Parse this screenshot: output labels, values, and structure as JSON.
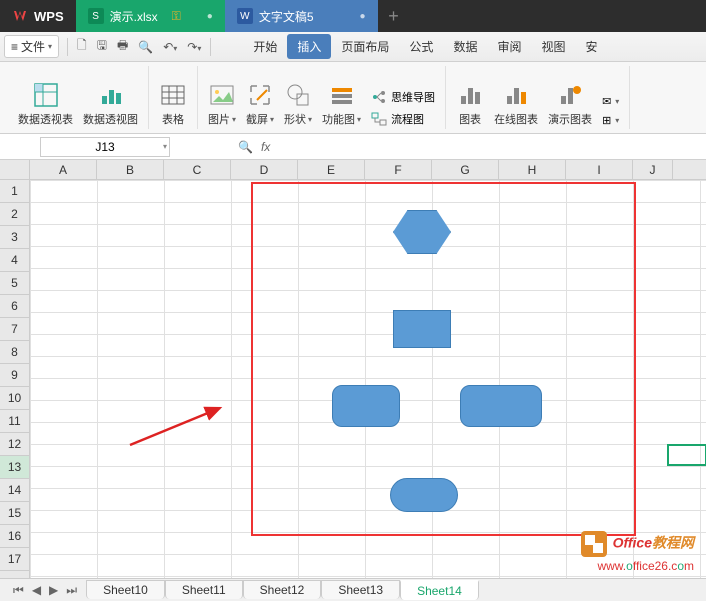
{
  "titlebar": {
    "app": "WPS",
    "tabs": [
      {
        "icon": "S",
        "label": "演示.xlsx",
        "type": "green"
      },
      {
        "icon": "W",
        "label": "文字文稿5",
        "type": "blue"
      }
    ]
  },
  "menubar": {
    "file": "文件",
    "tabs": [
      "开始",
      "插入",
      "页面布局",
      "公式",
      "数据",
      "审阅",
      "视图",
      "安"
    ]
  },
  "ribbon": {
    "pivot_table": "数据透视表",
    "pivot_chart": "数据透视图",
    "table": "表格",
    "picture": "图片",
    "screenshot": "截屏",
    "shapes": "形状",
    "smartart": "功能图",
    "mindmap": "思维导图",
    "flowchart": "流程图",
    "chart": "图表",
    "online_chart": "在线图表",
    "demo_chart": "演示图表"
  },
  "namebox": "J13",
  "columns": [
    "A",
    "B",
    "C",
    "D",
    "E",
    "F",
    "G",
    "H",
    "I",
    "J"
  ],
  "rows": [
    "1",
    "2",
    "3",
    "4",
    "5",
    "6",
    "7",
    "8",
    "9",
    "10",
    "11",
    "12",
    "13",
    "14",
    "15",
    "16",
    "17"
  ],
  "sheets": [
    "Sheet10",
    "Sheet11",
    "Sheet12",
    "Sheet13",
    "Sheet14"
  ],
  "active_sheet": "Sheet14",
  "watermark": {
    "line1_prefix": "Office",
    "line1_suffix": "教程网",
    "line2": "www.office26.com"
  }
}
